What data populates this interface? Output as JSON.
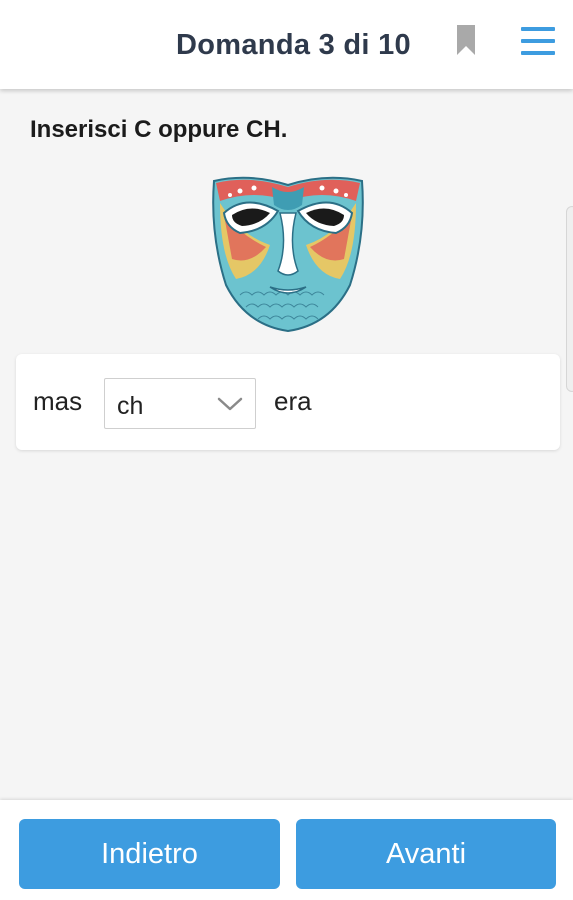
{
  "header": {
    "title": "Domanda 3 di 10",
    "bookmark_icon": "bookmark-icon",
    "menu_icon": "hamburger-menu-icon"
  },
  "question": {
    "prompt": "Inserisci C oppure CH.",
    "image": "carnival-mask-illustration"
  },
  "answer": {
    "word_before": "mas",
    "selected_option": "ch",
    "word_after": "era"
  },
  "footer": {
    "back_label": "Indietro",
    "next_label": "Avanti"
  },
  "colors": {
    "accent": "#3d9ce0",
    "title_text": "#2f3a4c",
    "background": "#f5f5f5"
  }
}
